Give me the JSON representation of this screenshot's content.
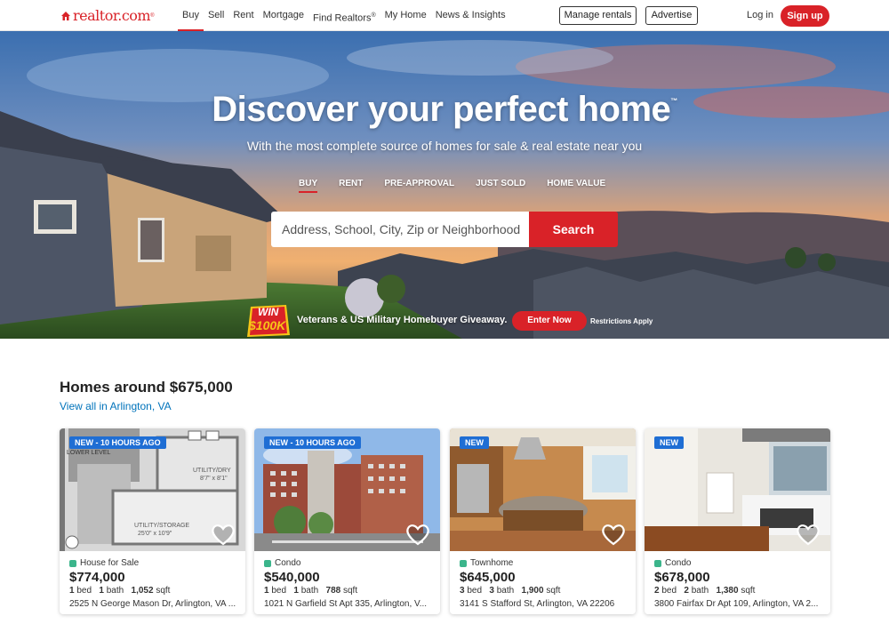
{
  "header": {
    "logo": "realtor.com",
    "logo_mark": "®",
    "nav": [
      "Buy",
      "Sell",
      "Rent",
      "Mortgage",
      "Find Realtors",
      "My Home",
      "News & Insights"
    ],
    "find_realtors_mark": "®",
    "manage_rentals": "Manage rentals",
    "advertise": "Advertise",
    "login": "Log in",
    "signup": "Sign up"
  },
  "hero": {
    "title": "Discover your perfect home",
    "title_mark": "™",
    "subtitle": "With the most complete source of homes for sale & real estate near you",
    "tabs": [
      "BUY",
      "RENT",
      "PRE-APPROVAL",
      "JUST SOLD",
      "HOME VALUE"
    ],
    "active_tab": "BUY",
    "search_placeholder": "Address, School, City, Zip or Neighborhood",
    "search_button": "Search",
    "promo_badge_top": "WIN",
    "promo_badge_bottom": "$100K",
    "promo_text": "Veterans & US Military Homebuyer Giveaway.",
    "promo_button": "Enter Now",
    "promo_note": "Restrictions Apply"
  },
  "listings": {
    "title": "Homes around $675,000",
    "link": "View all in Arlington, VA",
    "cards": [
      {
        "tag": "NEW - 10 HOURS AGO",
        "photo_label": "LOWER LEVEL",
        "room1": "UTILITY/DRY",
        "room1_size": "8'7\" x 8'1\"",
        "room2": "UTILITY/STORAGE",
        "room2_size": "25'0\" x 10'9\"",
        "type": "House for Sale",
        "price": "$774,000",
        "beds": "1",
        "baths": "1",
        "sqft": "1,052",
        "address": "2525 N George Mason Dr, Arlington, VA ..."
      },
      {
        "tag": "NEW - 10 HOURS AGO",
        "type": "Condo",
        "price": "$540,000",
        "beds": "1",
        "baths": "1",
        "sqft": "788",
        "address": "1021 N Garfield St Apt 335, Arlington, V..."
      },
      {
        "tag": "NEW",
        "type": "Townhome",
        "price": "$645,000",
        "beds": "3",
        "baths": "3",
        "sqft": "1,900",
        "address": "3141 S Stafford St, Arlington, VA 22206"
      },
      {
        "tag": "NEW",
        "type": "Condo",
        "price": "$678,000",
        "beds": "2",
        "baths": "2",
        "sqft": "1,380",
        "address": "3800 Fairfax Dr Apt 109, Arlington, VA 2..."
      }
    ],
    "bed_label": "bed",
    "bath_label": "bath",
    "sqft_label": "sqft"
  },
  "colors": {
    "brand_red": "#d92228",
    "tag_blue": "#1f6ed4",
    "status_green": "#3bb58b",
    "link_blue": "#0073bb"
  }
}
